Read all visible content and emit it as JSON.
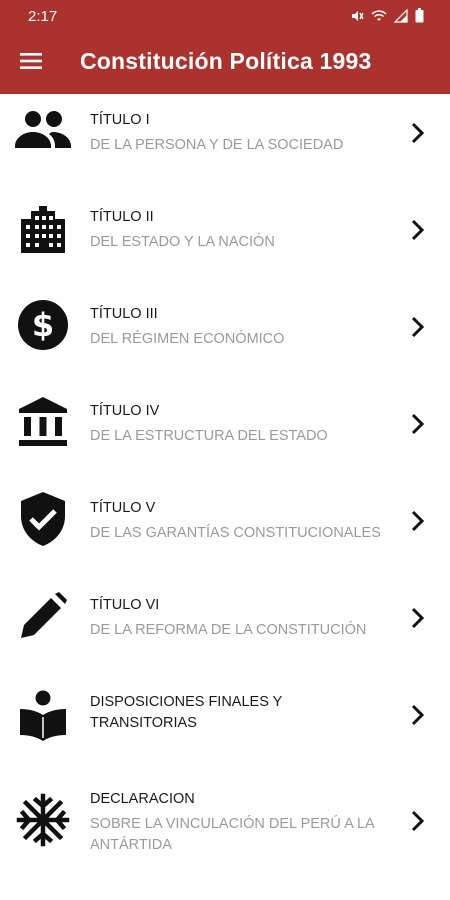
{
  "status_bar": {
    "time": "2:17",
    "icons": [
      "mute-icon",
      "wifi-icon",
      "signal-icon",
      "battery-icon"
    ]
  },
  "app_bar": {
    "title": "Constitución Política 1993",
    "menu_icon": "hamburger-menu-icon",
    "color": "#ab322d"
  },
  "items": [
    {
      "title": "TÍTULO I",
      "subtitle": "DE LA PERSONA Y DE LA SOCIEDAD",
      "icon": "people-icon"
    },
    {
      "title": "TÍTULO II",
      "subtitle": "DEL ESTADO Y LA NACIÓN",
      "icon": "building-icon"
    },
    {
      "title": "TÍTULO III",
      "subtitle": "DEL RÉGIMEN ECONÓMICO",
      "icon": "dollar-icon"
    },
    {
      "title": "TÍTULO IV",
      "subtitle": "DE LA ESTRUCTURA DEL ESTADO",
      "icon": "bank-icon"
    },
    {
      "title": "TÍTULO V",
      "subtitle": "DE LAS GARANTÍAS CONSTITUCIONALES",
      "icon": "shield-check-icon"
    },
    {
      "title": "TÍTULO VI",
      "subtitle": "DE LA REFORMA DE LA CONSTITUCIÓN",
      "icon": "pencil-icon"
    },
    {
      "title": "DISPOSICIONES FINALES Y\nTRANSITORIAS",
      "subtitle": "",
      "icon": "reading-person-icon"
    },
    {
      "title": "DECLARACION",
      "subtitle": "SOBRE LA VINCULACIÓN DEL PERÚ A LA ANTÁRTIDA",
      "icon": "snowflake-icon"
    }
  ]
}
